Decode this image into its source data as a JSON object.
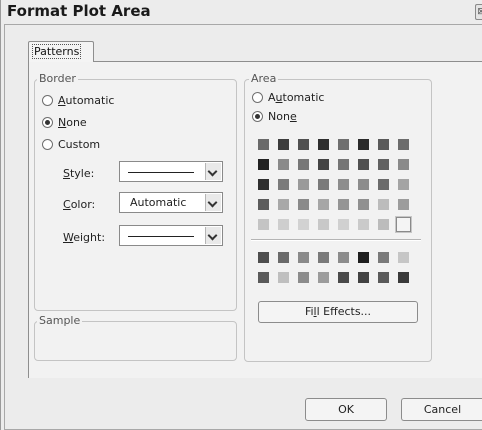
{
  "window": {
    "title": "Format Plot Area",
    "close_glyph": "⊠"
  },
  "tabs": [
    {
      "label": "Patterns"
    }
  ],
  "border": {
    "caption": "Border",
    "options": [
      {
        "label": "Automatic",
        "mnemonic": "A",
        "checked": false
      },
      {
        "label": "None",
        "mnemonic": "N",
        "checked": true
      },
      {
        "label": "Custom",
        "mnemonic": "",
        "checked": false
      }
    ],
    "style": {
      "label": "Style:",
      "mnemonic": "S"
    },
    "color": {
      "label": "Color:",
      "mnemonic": "C",
      "value": "Automatic"
    },
    "weight": {
      "label": "Weight:",
      "mnemonic": "W"
    }
  },
  "sample": {
    "caption": "Sample"
  },
  "area": {
    "caption": "Area",
    "options": [
      {
        "label": "Automatic",
        "mnemonic": "u",
        "checked": false
      },
      {
        "label": "None",
        "mnemonic": "e",
        "checked": true
      }
    ],
    "palette_rows": [
      [
        "#6a6a6a",
        "#3c3c3c",
        "#505050",
        "#2e2e2e",
        "#6f6f6f",
        "#2a2a2a",
        "#5a5a5a",
        "#6c6c6c"
      ],
      [
        "#222222",
        "#8a8a8a",
        "#777777",
        "#444444",
        "#757575",
        "#505050",
        "#616161",
        "#8a8a8a"
      ],
      [
        "#2f2f2f",
        "#7b7b7b",
        "#9a9a9a",
        "#7a7a7a",
        "#8d8d8d",
        "#8c8c8c",
        "#6b6b6b",
        "#a4a4a4"
      ],
      [
        "#5c5c5c",
        "#a8a8a8",
        "#8a8a8a",
        "#a6a6a6",
        "#959595",
        "#909090",
        "#bcbcbc",
        "#9c9c9c"
      ],
      [
        "#c4c4c4",
        "#cecece",
        "#d2d2d2",
        "#c8c8c8",
        "#d0d0d0",
        "#cacaca",
        "#bcbcbc",
        "#f4f4f4"
      ]
    ],
    "extra_rows": [
      [
        "#4e4e4e",
        "#6a6a6a",
        "#8a8a8a",
        "#7a7a7a",
        "#8c8c8c",
        "#1e1e1e",
        "#7a7a7a",
        "#c6c6c6"
      ],
      [
        "#5a5a5a",
        "#bfbfbf",
        "#8c8c8c",
        "#9c9c9c",
        "#4a4a4a",
        "#424242",
        "#5a5a5a",
        "#3a3a3a"
      ]
    ],
    "selected_swatch": [
      4,
      7
    ],
    "fill_effects_label": "Fill Effects...",
    "fill_effects_mnemonic": "l"
  },
  "buttons": {
    "ok": "OK",
    "cancel": "Cancel"
  }
}
